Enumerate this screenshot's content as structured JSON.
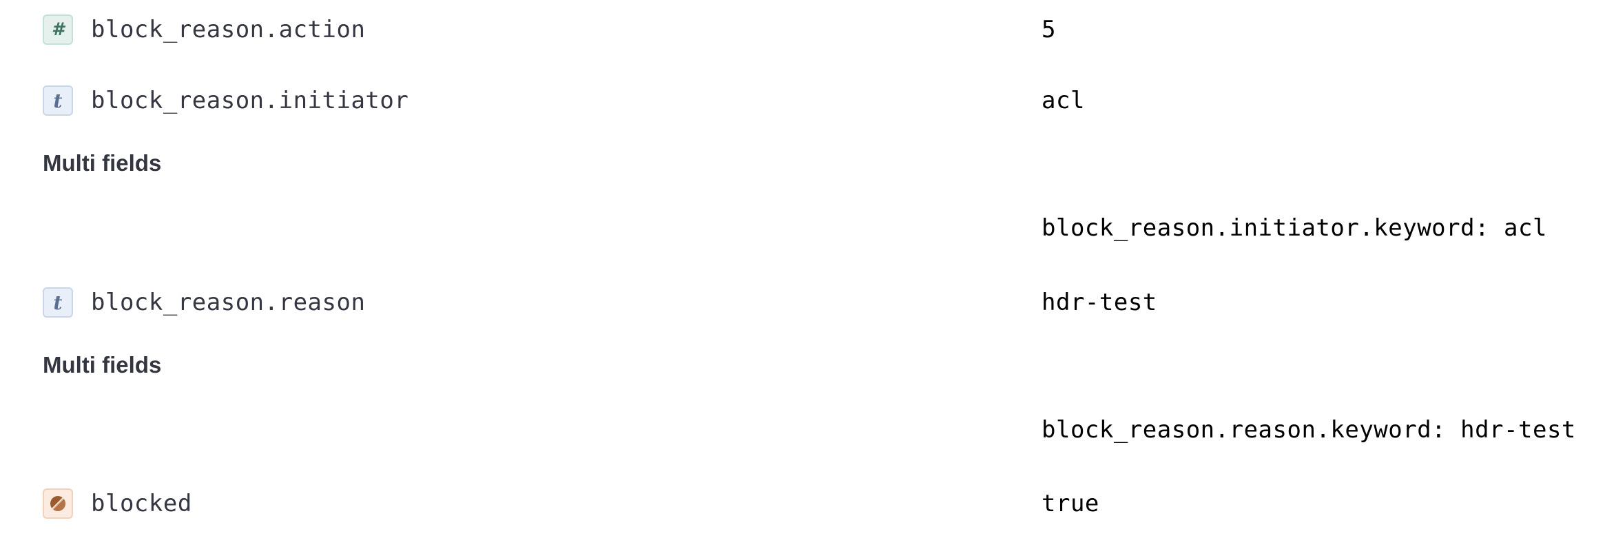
{
  "rows": [
    {
      "field": "block_reason.action",
      "type_icon": "number-type-icon",
      "type_glyph": "#",
      "value": "5"
    },
    {
      "field": "block_reason.initiator",
      "type_icon": "string-type-icon",
      "type_glyph": "t",
      "value": "acl",
      "multi_fields_label": "Multi fields",
      "multi_fields": [
        "block_reason.initiator.keyword: acl"
      ]
    },
    {
      "field": "block_reason.reason",
      "type_icon": "string-type-icon",
      "type_glyph": "t",
      "value": "hdr-test",
      "multi_fields_label": "Multi fields",
      "multi_fields": [
        "block_reason.reason.keyword: hdr-test"
      ]
    },
    {
      "field": "blocked",
      "type_icon": "boolean-type-icon",
      "value": "true"
    }
  ],
  "colors": {
    "text": "#343741",
    "value_text": "#000000",
    "number_icon_bg": "#e6f1ee",
    "string_icon_bg": "#e9eff8",
    "boolean_icon_bg": "#fbebe0",
    "boolean_glyph": "#9a5a2c"
  }
}
